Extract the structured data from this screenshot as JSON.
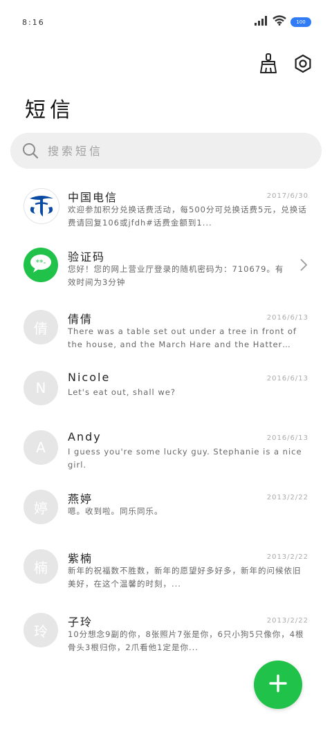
{
  "status_bar": {
    "time": "8:16",
    "battery_level": "100",
    "signal_icon": "signal-icon",
    "wifi_icon": "wifi-icon"
  },
  "toolbar": {
    "clean_icon": "broom-icon",
    "settings_icon": "gear-icon"
  },
  "title": "短信",
  "search": {
    "placeholder": "搜索短信"
  },
  "messages": [
    {
      "name": "中国电信",
      "date": "2017/6/30",
      "preview": "欢迎参加积分兑换话费活动，每500分可兑换话费5元，兑换话费请回复106或jfdh#话费金额到1...",
      "avatar": "telecom-logo",
      "avatar_color": "#0b4aa2"
    },
    {
      "name": "验证码",
      "date": "",
      "preview": "您好！您的网上营业厅登录的随机密码为：710679。有效时间为3分钟",
      "avatar": "message-bubble-icon",
      "avatar_color": "#21c24a"
    },
    {
      "name": "倩倩",
      "date": "2016/6/13",
      "preview": "There was a table set out under a tree in front of the house, and the March Hare and the Hatter were having te...",
      "avatar": "倩"
    },
    {
      "name": "Nicole",
      "date": "2016/6/13",
      "preview": "Let's eat out, shall we?",
      "avatar": "N"
    },
    {
      "name": "Andy",
      "date": "2016/6/13",
      "preview": "I guess you're some lucky guy. Stephanie is a nice girl.",
      "avatar": "A"
    },
    {
      "name": "燕婷",
      "date": "2013/2/22",
      "preview": "嗯。收到啦。同乐同乐。",
      "avatar": "婷"
    },
    {
      "name": "紫楠",
      "date": "2013/2/22",
      "preview": "新年的祝福数不胜数，新年的愿望好多好多，新年的问候依旧美好，在这个温馨的时刻，...",
      "avatar": "楠"
    },
    {
      "name": "子玲",
      "date": "2013/2/22",
      "preview": "10分想念9副的你，8张照片7张是你，6只小狗5只像你，4根骨头3根归你，2爪看他1定是你...",
      "avatar": "玲"
    }
  ],
  "fab": {
    "icon": "plus-icon",
    "color": "#21c24a"
  }
}
